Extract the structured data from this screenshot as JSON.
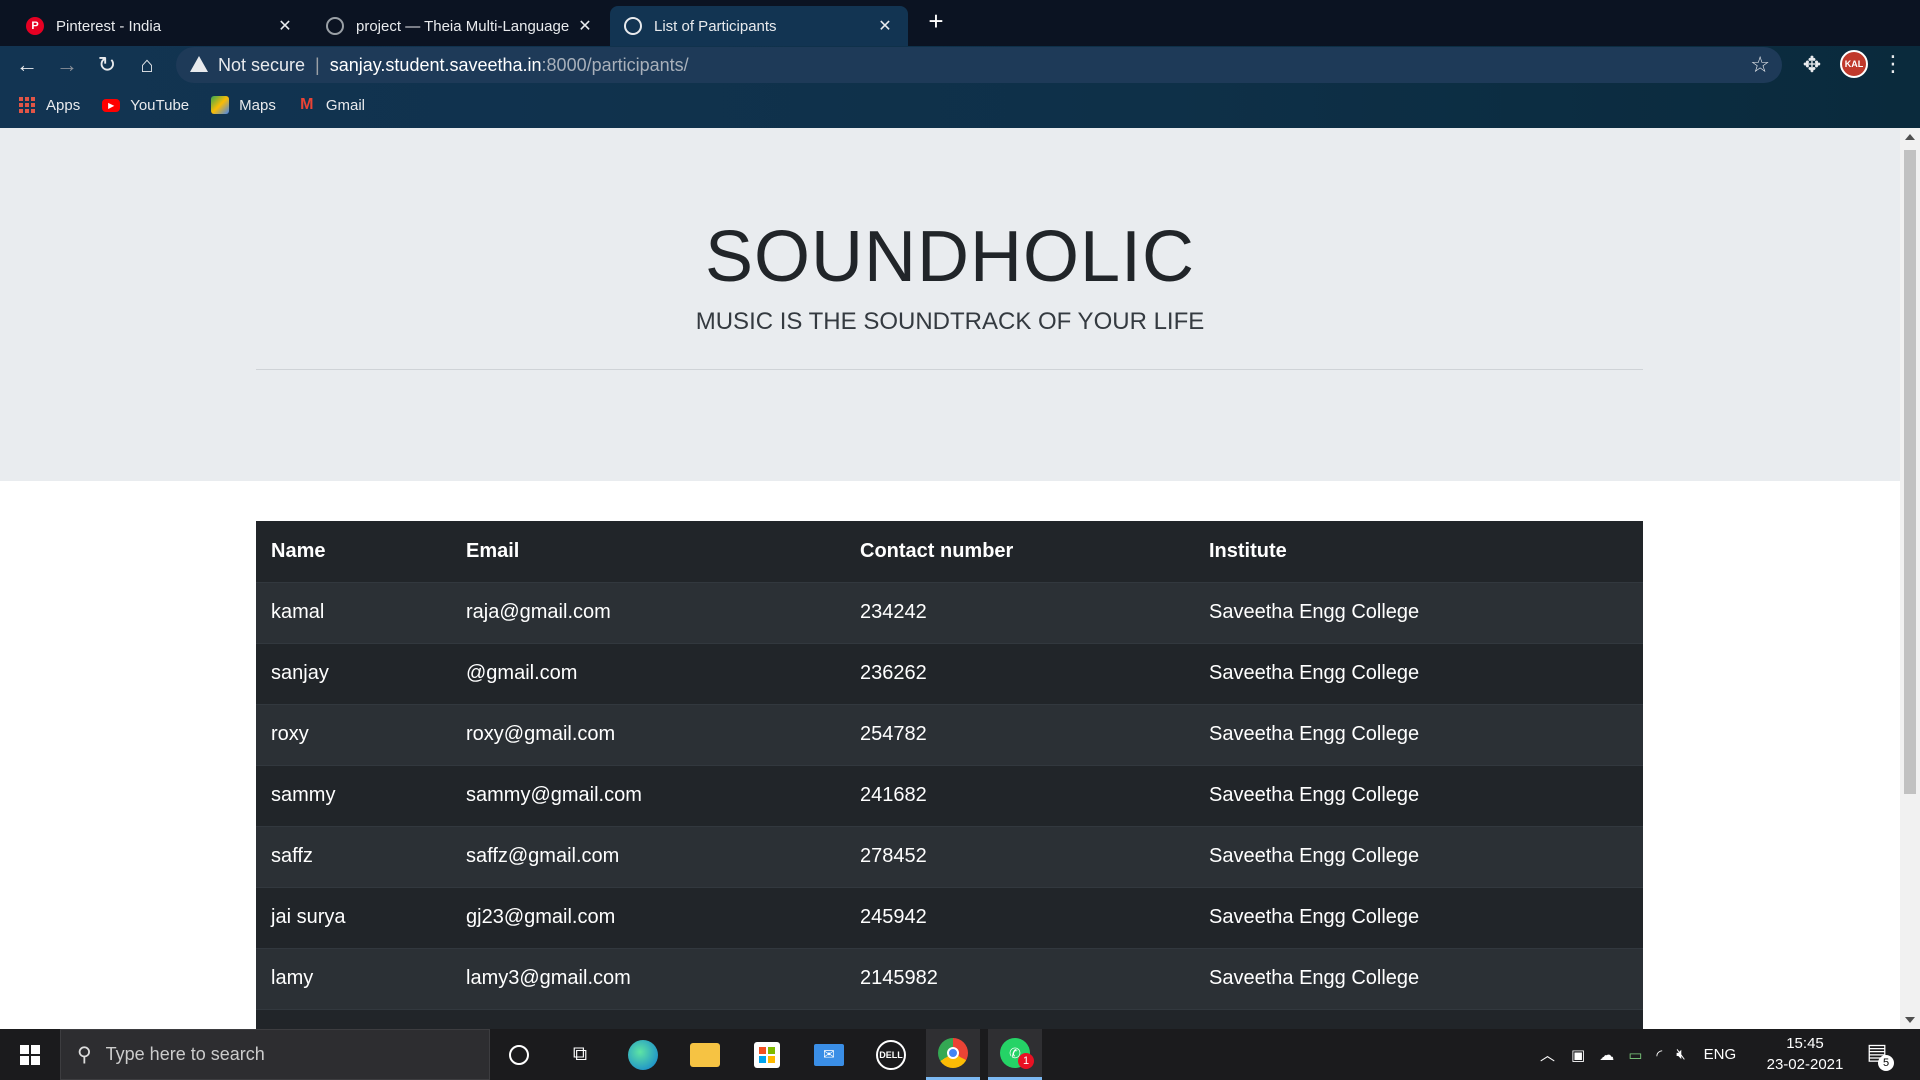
{
  "browser": {
    "tabs": [
      {
        "title": "Pinterest - India",
        "icon": "pinterest-icon",
        "active": false
      },
      {
        "title": "project — Theia Multi-Language",
        "icon": "globe-icon",
        "active": false
      },
      {
        "title": "List of Participants",
        "icon": "globe-icon",
        "active": true
      }
    ],
    "address": {
      "security_label": "Not secure",
      "host": "sanjay.student.saveetha.in",
      "path": ":8000/participants/"
    },
    "profile_initials": "KAL",
    "bookmarks": [
      {
        "label": "Apps",
        "icon": "apps-grid-icon"
      },
      {
        "label": "YouTube",
        "icon": "youtube-icon"
      },
      {
        "label": "Maps",
        "icon": "maps-icon"
      },
      {
        "label": "Gmail",
        "icon": "gmail-icon"
      }
    ]
  },
  "page": {
    "title": "SOUNDHOLIC",
    "tagline": "MUSIC IS THE SOUNDTRACK OF YOUR LIFE",
    "table": {
      "headers": [
        "Name",
        "Email",
        "Contact number",
        "Institute"
      ],
      "rows": [
        [
          "kamal",
          "raja@gmail.com",
          "234242",
          "Saveetha Engg College"
        ],
        [
          "sanjay",
          "@gmail.com",
          "236262",
          "Saveetha Engg College"
        ],
        [
          "roxy",
          "roxy@gmail.com",
          "254782",
          "Saveetha Engg College"
        ],
        [
          "sammy",
          "sammy@gmail.com",
          "241682",
          "Saveetha Engg College"
        ],
        [
          "saffz",
          "saffz@gmail.com",
          "278452",
          "Saveetha Engg College"
        ],
        [
          "jai surya",
          "gj23@gmail.com",
          "245942",
          "Saveetha Engg College"
        ],
        [
          "lamy",
          "lamy3@gmail.com",
          "2145982",
          "Saveetha Engg College"
        ],
        [
          "",
          "",
          "",
          ""
        ]
      ]
    }
  },
  "taskbar": {
    "search_placeholder": "Type here to search",
    "whatsapp_badge": "1",
    "language": "ENG",
    "time": "15:45",
    "date": "23-02-2021",
    "notification_count": "5"
  },
  "colors": {
    "hero_bg": "#e9ecef",
    "table_bg": "#212529",
    "table_stripe": "#2b3035"
  }
}
